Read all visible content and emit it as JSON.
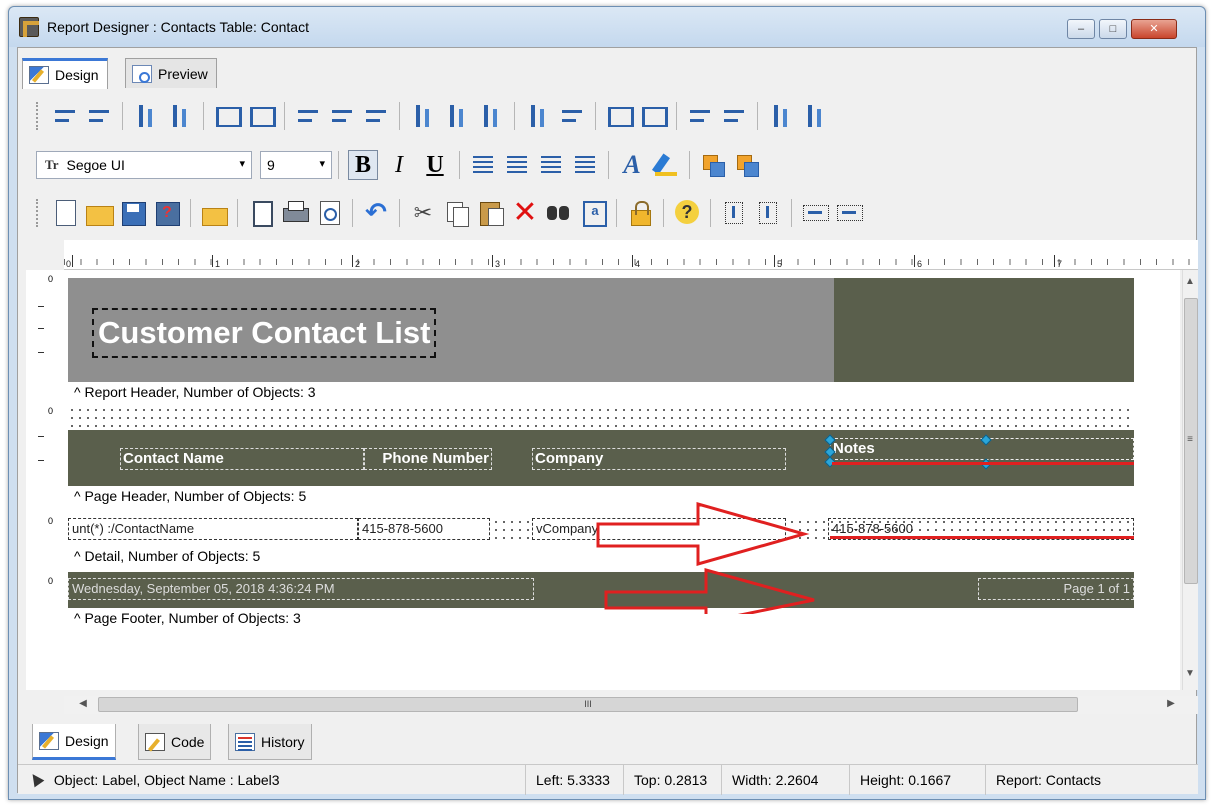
{
  "window": {
    "title": "Report Designer : Contacts Table: Contact",
    "minimize": "–",
    "maximize": "□",
    "close": "✕"
  },
  "top_tabs": [
    {
      "label": "Design",
      "icon": "design-icon",
      "active": true
    },
    {
      "label": "Preview",
      "icon": "preview-icon",
      "active": false
    }
  ],
  "format_toolbar": {
    "font": "Segoe UI",
    "font_icon": "Tr",
    "size": "9",
    "dropdown": "▾",
    "bold": "B",
    "italic": "I",
    "underline": "U",
    "font_color": "A"
  },
  "ruler": {
    "numbers": [
      "0",
      "1",
      "2",
      "3",
      "4",
      "5",
      "6",
      "7"
    ]
  },
  "report": {
    "title": "Customer Contact List",
    "report_header_caption": "^ Report Header, Number of Objects: 3",
    "page_header_caption": "^ Page Header, Number of Objects: 5",
    "detail_caption": "^ Detail, Number of Objects: 5",
    "page_footer_caption": "^ Page Footer, Number of Objects: 3",
    "page_header_labels": [
      "Contact Name",
      "Phone Number",
      "Company",
      "Notes"
    ],
    "detail_fields": [
      "unt(*) :/ContactName",
      "415-878-5600",
      "vCompany",
      "415-878-5600"
    ],
    "footer_date": "Wednesday, September 05, 2018 4:36:24 PM",
    "footer_page": "Page 1 of 1",
    "section_markers": [
      "0",
      "0",
      "0",
      "0"
    ]
  },
  "scrollbar": {
    "thumb_mark": "III",
    "up": "▲",
    "down": "▼",
    "left": "◀",
    "right": "▶",
    "grip": "≡"
  },
  "bottom_tabs": [
    {
      "label": "Design",
      "icon": "design-icon",
      "active": true
    },
    {
      "label": "Code",
      "icon": "code-icon",
      "active": false
    },
    {
      "label": "History",
      "icon": "history-icon",
      "active": false
    }
  ],
  "status": {
    "object": "Object: Label, Object Name : Label3",
    "left": "Left: 5.3333",
    "top": "Top: 0.2813",
    "width": "Width: 2.2604",
    "height": "Height: 0.1667",
    "report": "Report: Contacts"
  },
  "colors": {
    "header_gray": "#8f8f8f",
    "band_dark": "#5a5f4c",
    "arrow_red": "#e02020",
    "selection_handle": "#2aa6d9"
  }
}
